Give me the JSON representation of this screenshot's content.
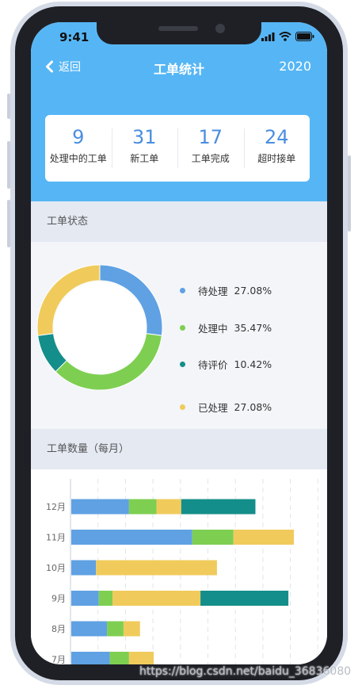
{
  "status": {
    "time": "9:41"
  },
  "nav": {
    "back_label": "返回",
    "title": "工单统计",
    "year": "2020"
  },
  "stats": [
    {
      "value": "9",
      "label": "处理中的工单"
    },
    {
      "value": "31",
      "label": "新工单"
    },
    {
      "value": "17",
      "label": "工单完成"
    },
    {
      "value": "24",
      "label": "超时接单"
    }
  ],
  "status_section": {
    "title": "工单状态"
  },
  "monthly_section": {
    "title": "工单数量（每月）"
  },
  "legend": [
    {
      "name": "待处理",
      "pct": "27.08%",
      "color": "#5fa1e3"
    },
    {
      "name": "处理中",
      "pct": "35.47%",
      "color": "#7ecf51"
    },
    {
      "name": "待评价",
      "pct": "10.42%",
      "color": "#148e8a"
    },
    {
      "name": "已处理",
      "pct": "27.08%",
      "color": "#f0cb5c"
    }
  ],
  "chart_data": [
    {
      "type": "pie",
      "categories": [
        "待处理",
        "处理中",
        "待评价",
        "已处理"
      ],
      "values": [
        27.08,
        35.47,
        10.42,
        27.08
      ],
      "colors": [
        "#5fa1e3",
        "#7ecf51",
        "#148e8a",
        "#f0cb5c"
      ],
      "donut": true
    },
    {
      "type": "bar",
      "orientation": "horizontal",
      "stacked": true,
      "categories": [
        "12月",
        "11月",
        "10月",
        "9月",
        "8月",
        "7月"
      ],
      "series": [
        {
          "values": [
            21,
            44,
            9,
            10,
            13,
            14
          ],
          "color": "#5fa1e3"
        },
        {
          "values": [
            10,
            15,
            0,
            5,
            6,
            7
          ],
          "color": "#7ecf51"
        },
        {
          "values": [
            9,
            22,
            44,
            32,
            6,
            9
          ],
          "color": "#f0cb5c"
        },
        {
          "values": [
            27,
            0,
            0,
            32,
            0,
            0
          ],
          "color": "#148e8a"
        }
      ],
      "xlim": [
        0,
        90
      ],
      "grid": true
    }
  ],
  "watermark": "https://blog.csdn.net/baidu_36836080",
  "colors": {
    "header": "#56b6f5",
    "accent": "#4a8ee0",
    "section": "#e4e9f2"
  }
}
